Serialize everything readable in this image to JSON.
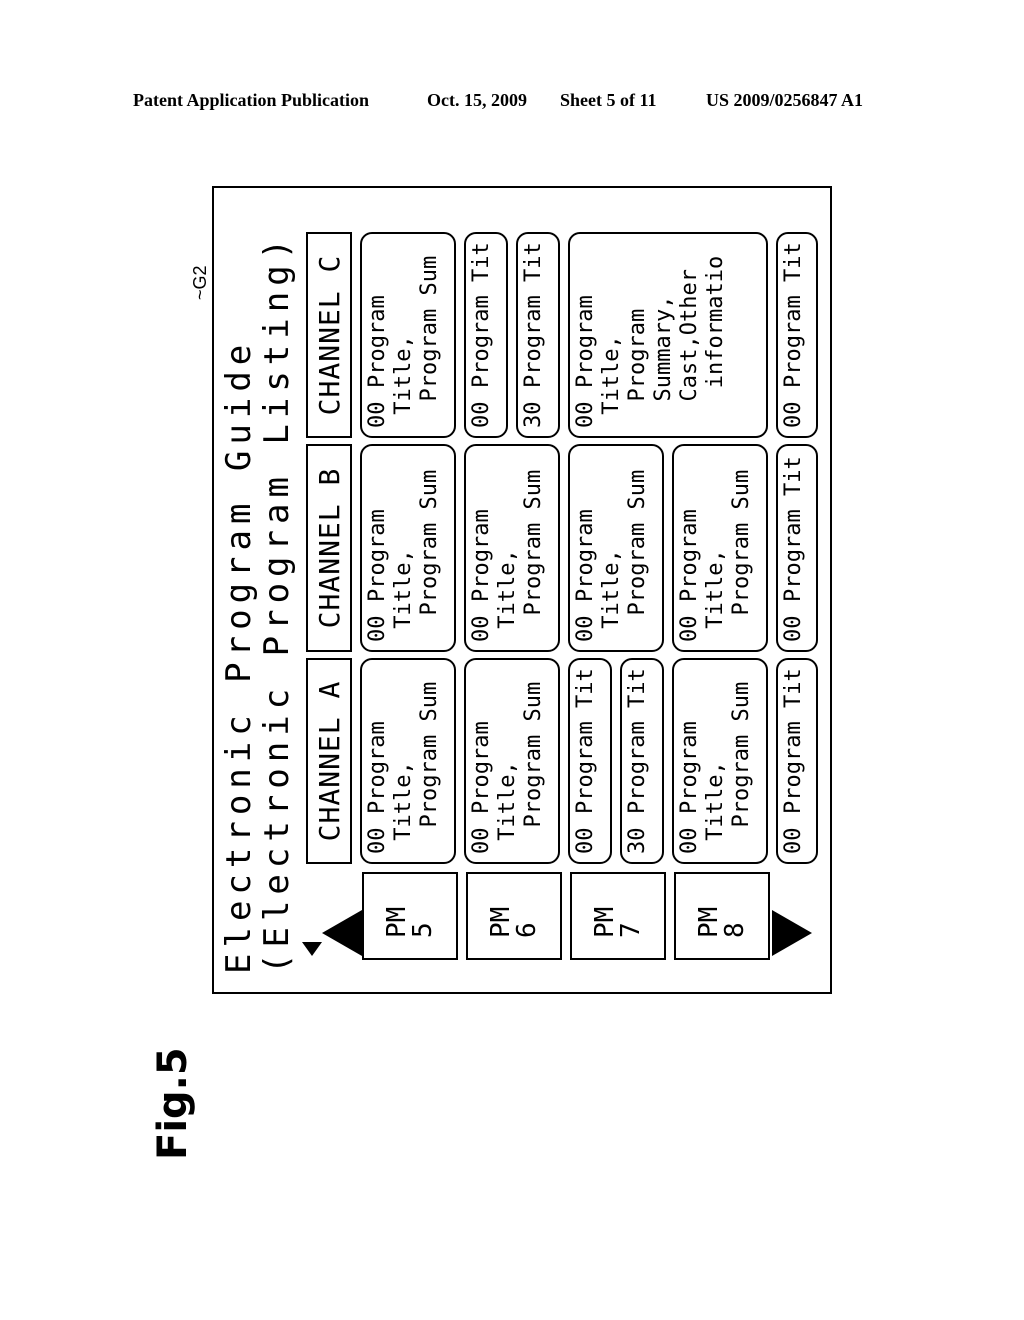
{
  "header": {
    "left": "Patent Application Publication",
    "date": "Oct. 15, 2009",
    "sheet": "Sheet 5 of 11",
    "number": "US 2009/0256847 A1"
  },
  "figure_label": "Fig.5",
  "reference": "~G2",
  "epg": {
    "title": "Electronic Program Guide",
    "subtitle": "(Electronic Program Listing)",
    "channels": [
      "CHANNEL A",
      "CHANNEL B",
      "CHANNEL C"
    ],
    "times": [
      {
        "pm": "PM",
        "hour": "5"
      },
      {
        "pm": "PM",
        "hour": "6"
      },
      {
        "pm": "PM",
        "hour": "7"
      },
      {
        "pm": "PM",
        "hour": "8"
      }
    ],
    "programs": {
      "a": [
        {
          "min": "00",
          "text": "Program\n Title,\n  Program Sum"
        },
        {
          "min": "00",
          "text": "Program\n Title,\n  Program Sum"
        },
        {
          "min": "00",
          "text": "Program Tit"
        },
        {
          "min": "30",
          "text": "Program Tit"
        },
        {
          "min": "00",
          "text": "Program\n Title,\n  Program Sum"
        },
        {
          "min": "00",
          "text": "Program Tit"
        }
      ],
      "b": [
        {
          "min": "00",
          "text": "Program\n Title,\n  Program Sum"
        },
        {
          "min": "00",
          "text": "Program\n Title,\n  Program Sum"
        },
        {
          "min": "00",
          "text": "Program\n Title,\n  Program Sum"
        },
        {
          "min": "00",
          "text": "Program\n Title,\n  Program Sum"
        },
        {
          "min": "00",
          "text": "Program Tit"
        }
      ],
      "c": [
        {
          "min": "00",
          "text": "Program\n Title,\n  Program Sum"
        },
        {
          "min": "00",
          "text": "Program Tit"
        },
        {
          "min": "30",
          "text": "Program Tit"
        },
        {
          "min": "00",
          "text": "Program\n Title,\n  Program\n  Summary,\n  Cast,Other\n   informatio"
        },
        {
          "min": "00",
          "text": "Program Tit"
        }
      ]
    },
    "nav": {
      "up": "scroll-up-arrow",
      "down": "scroll-down-arrow",
      "left": "scroll-left-arrow"
    }
  }
}
